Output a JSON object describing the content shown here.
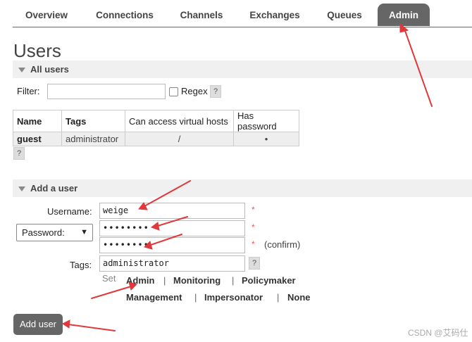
{
  "nav": {
    "tabs": [
      "Overview",
      "Connections",
      "Channels",
      "Exchanges",
      "Queues",
      "Admin"
    ],
    "active": "Admin"
  },
  "page_title": "Users",
  "all_users": {
    "title": "All users",
    "filter_label": "Filter:",
    "filter_value": "",
    "regex_label": "Regex",
    "help": "?",
    "columns": [
      "Name",
      "Tags",
      "Can access virtual hosts",
      "Has password"
    ],
    "rows": [
      {
        "name": "guest",
        "tags": "administrator",
        "vhosts": "/",
        "has_password": "•"
      }
    ]
  },
  "add_user": {
    "title": "Add a user",
    "username_label": "Username:",
    "username_value": "weige",
    "password_mode": "Password:",
    "password_masked": "••••••••",
    "confirm_masked": "••••••••",
    "confirm_label": "(confirm)",
    "tags_label": "Tags:",
    "tags_value": "administrator",
    "required_mark": "*",
    "set_label": "Set",
    "tag_options": [
      "Admin",
      "Monitoring",
      "Policymaker",
      "Management",
      "Impersonator",
      "None"
    ],
    "separator": "|",
    "submit_label": "Add user"
  },
  "watermark": "CSDN @艾码仕",
  "colors": {
    "tab_active_bg": "#666666",
    "section_bg": "#f0f0f0",
    "annotation_arrow": "#e0393b",
    "required": "#e05a5a"
  }
}
